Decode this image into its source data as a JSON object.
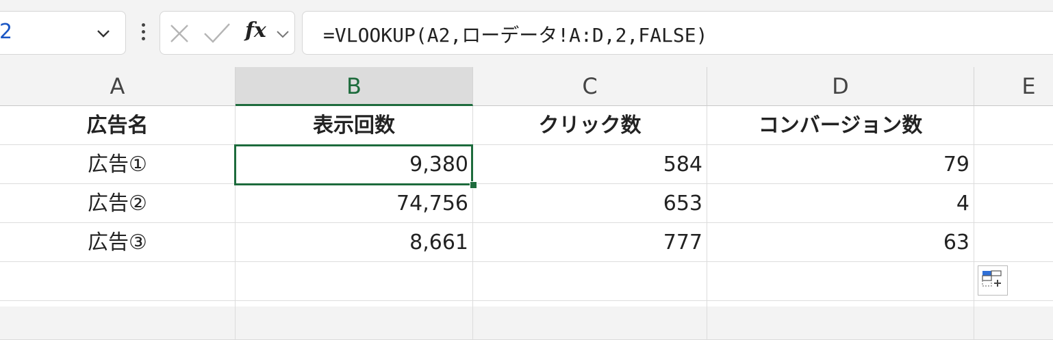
{
  "name_box": {
    "value": "2"
  },
  "formula_bar": {
    "fx_label": "fx",
    "formula": "=VLOOKUP(A2,ローデータ!A:D,2,FALSE)"
  },
  "columns": [
    "A",
    "B",
    "C",
    "D",
    "E"
  ],
  "selected_column": "B",
  "header_row": [
    "広告名",
    "表示回数",
    "クリック数",
    "コンバージョン数",
    ""
  ],
  "rows": [
    [
      "広告①",
      "9,380",
      "584",
      "79",
      ""
    ],
    [
      "広告②",
      "74,756",
      "653",
      "4",
      ""
    ],
    [
      "広告③",
      "8,661",
      "777",
      "63",
      ""
    ]
  ],
  "colors": {
    "accent": "#1d6b3c",
    "name_box_text": "#1a56c4"
  },
  "icons": [
    "chevron-down-icon",
    "more-vertical-icon",
    "cancel-icon",
    "checkmark-icon",
    "fx-icon",
    "quick-analysis-icon"
  ]
}
